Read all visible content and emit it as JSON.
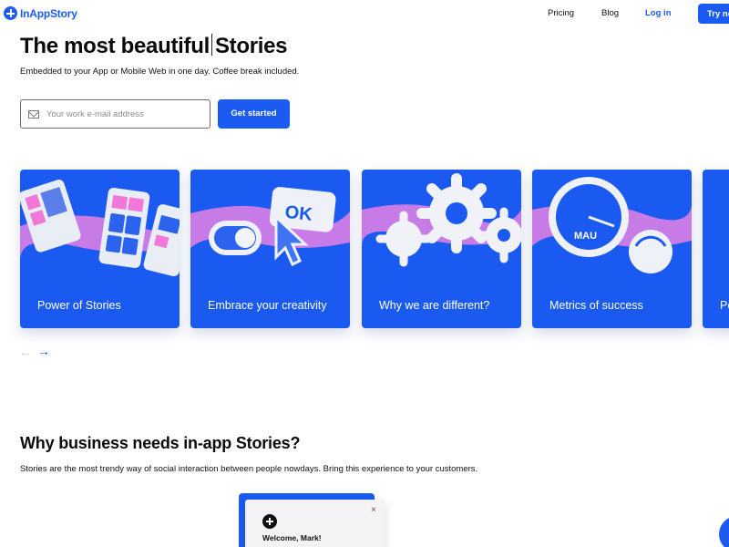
{
  "header": {
    "brand": "InAppStory",
    "nav": [
      "Pricing",
      "Blog"
    ],
    "login": "Log in",
    "try": "Try now"
  },
  "hero": {
    "title_part1": "The most beautiful",
    "title_part2": "Stories",
    "subtitle": "Embedded to your App or Mobile Web in one day. Coffee break included.",
    "email_placeholder": "Your work e-mail address",
    "cta": "Get started"
  },
  "cards": [
    {
      "label": "Power of Stories"
    },
    {
      "label": "Embrace your creativity"
    },
    {
      "label": "Why we are different?"
    },
    {
      "label": "Metrics of success"
    },
    {
      "label": "Po"
    }
  ],
  "carousel_icons": [
    "arrow-left-icon",
    "arrow-right-icon"
  ],
  "section2": {
    "title": "Why business needs in-app Stories?",
    "subtitle": "Stories are the most trendy way of social interaction between people nowdays. Bring this experience to your customers."
  },
  "preview": {
    "close": "×",
    "welcome": "Welcome, Mark!"
  },
  "colors": {
    "brand_blue": "#1b5bf2",
    "card_blue": "#1a5af1",
    "band_pink": "#c77be6"
  }
}
